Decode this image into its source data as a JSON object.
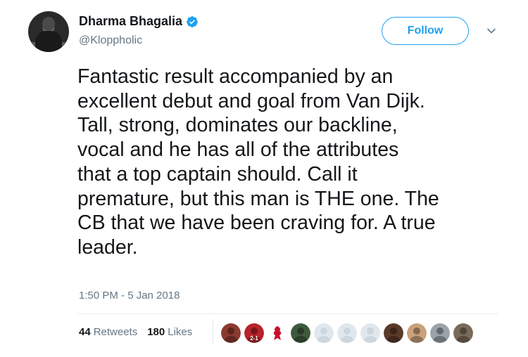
{
  "author": {
    "name": "Dharma Bhagalia",
    "handle": "@Kloppholic"
  },
  "header": {
    "follow_label": "Follow"
  },
  "tweet": {
    "lines": [
      "Fantastic result accompanied by an",
      "excellent debut and goal from Van Dijk.",
      "Tall, strong, dominates our backline,",
      "vocal and he has all of the attributes",
      "that a top captain should. Call it",
      "premature, but this man is THE one. The",
      "CB that we have been craving for. A true",
      "leader."
    ],
    "timestamp": "1:50 PM - 5 Jan 2018"
  },
  "stats": {
    "retweets_count": "44",
    "retweets_label": "Retweets",
    "likes_count": "180",
    "likes_label": "Likes"
  },
  "likers": [
    {
      "icon": "user-avatar",
      "color": "#8a3a2e"
    },
    {
      "icon": "user-avatar-scoreboard",
      "color": "#b8232b",
      "text": "2-1"
    },
    {
      "icon": "liverpool-crest",
      "color": "#c8102e"
    },
    {
      "icon": "user-avatar",
      "color": "#3d5a3d"
    },
    {
      "icon": "default-avatar",
      "color": "#ccd6dd"
    },
    {
      "icon": "default-avatar",
      "color": "#ccd6dd"
    },
    {
      "icon": "default-avatar",
      "color": "#ccd6dd"
    },
    {
      "icon": "user-avatar",
      "color": "#5a3a2a"
    },
    {
      "icon": "user-avatar",
      "color": "#c9a27a"
    },
    {
      "icon": "user-avatar",
      "color": "#9aa3aa"
    },
    {
      "icon": "user-avatar",
      "color": "#7a6a5a"
    }
  ],
  "colors": {
    "accent": "#1da1f2",
    "text": "#14171a",
    "muted": "#657786",
    "border": "#e6ecf0"
  }
}
